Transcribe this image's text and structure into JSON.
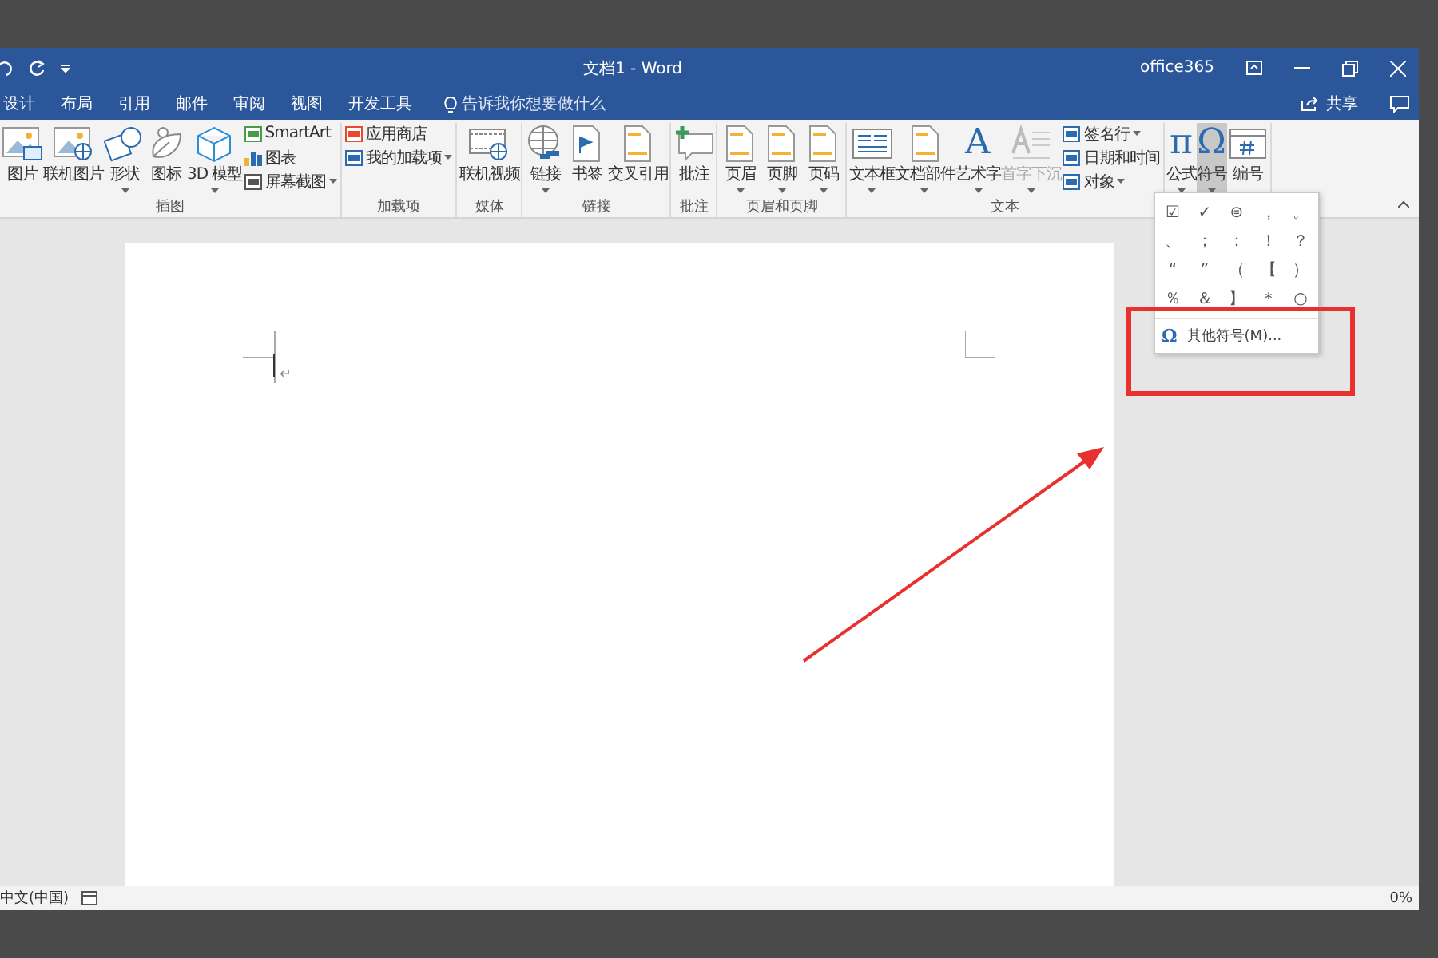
{
  "window": {
    "title": "文档1 - Word",
    "account": "office365"
  },
  "tabs": [
    {
      "label": "设计"
    },
    {
      "label": "布局"
    },
    {
      "label": "引用"
    },
    {
      "label": "邮件"
    },
    {
      "label": "审阅"
    },
    {
      "label": "视图"
    },
    {
      "label": "开发工具"
    }
  ],
  "tell_me": {
    "placeholder": "告诉我你想要做什么"
  },
  "share": {
    "label": "共享"
  },
  "ribbon": {
    "groups": [
      {
        "label": "插图",
        "buttons": [
          {
            "kind": "large",
            "label": "图片",
            "has_menu": false,
            "expanded": false,
            "disabled": false
          },
          {
            "kind": "large",
            "label": "联机图片",
            "has_menu": false,
            "expanded": false,
            "disabled": false
          },
          {
            "kind": "large",
            "label": "形状",
            "has_menu": true,
            "expanded": false,
            "disabled": false
          },
          {
            "kind": "large",
            "label": "图标",
            "has_menu": false,
            "expanded": false,
            "disabled": false
          },
          {
            "kind": "large",
            "label": "3D 模型",
            "has_menu": true,
            "expanded": false,
            "disabled": false
          },
          {
            "kind": "stack",
            "items": [
              {
                "label": "SmartArt",
                "has_menu": false
              },
              {
                "label": "图表",
                "has_menu": false
              },
              {
                "label": "屏幕截图",
                "has_menu": true
              }
            ]
          }
        ]
      },
      {
        "label": "加载项",
        "buttons": [
          {
            "kind": "stack",
            "items": [
              {
                "label": "应用商店",
                "has_menu": false
              },
              {
                "label": "我的加载项",
                "has_menu": true
              }
            ]
          }
        ]
      },
      {
        "label": "媒体",
        "buttons": [
          {
            "kind": "large",
            "label": "联机视频",
            "has_menu": false,
            "expanded": false,
            "disabled": false
          }
        ]
      },
      {
        "label": "链接",
        "buttons": [
          {
            "kind": "large",
            "label": "链接",
            "has_menu": true,
            "expanded": false,
            "disabled": false
          },
          {
            "kind": "large",
            "label": "书签",
            "has_menu": false,
            "expanded": false,
            "disabled": false
          },
          {
            "kind": "large",
            "label": "交叉引用",
            "has_menu": false,
            "expanded": false,
            "disabled": false
          }
        ]
      },
      {
        "label": "批注",
        "buttons": [
          {
            "kind": "large",
            "label": "批注",
            "has_menu": false,
            "expanded": false,
            "disabled": false
          }
        ]
      },
      {
        "label": "页眉和页脚",
        "buttons": [
          {
            "kind": "large",
            "label": "页眉",
            "has_menu": true,
            "expanded": false,
            "disabled": false
          },
          {
            "kind": "large",
            "label": "页脚",
            "has_menu": true,
            "expanded": false,
            "disabled": false
          },
          {
            "kind": "large",
            "label": "页码",
            "has_menu": true,
            "expanded": false,
            "disabled": false
          }
        ]
      },
      {
        "label": "文本",
        "buttons": [
          {
            "kind": "large",
            "label": "文本框",
            "has_menu": true,
            "expanded": false,
            "disabled": false
          },
          {
            "kind": "large",
            "label": "文档部件",
            "has_menu": true,
            "expanded": false,
            "disabled": false
          },
          {
            "kind": "large",
            "label": "艺术字",
            "glyph": "A",
            "has_menu": true,
            "expanded": false,
            "disabled": false
          },
          {
            "kind": "large",
            "label": "首字下沉",
            "has_menu": true,
            "expanded": false,
            "disabled": true
          },
          {
            "kind": "stack",
            "items": [
              {
                "label": "签名行",
                "has_menu": true
              },
              {
                "label": "日期和时间",
                "has_menu": false
              },
              {
                "label": "对象",
                "has_menu": true
              }
            ]
          }
        ]
      },
      {
        "buttons": [
          {
            "kind": "large",
            "label": "公式",
            "glyph": "π",
            "has_menu": true,
            "expanded": false,
            "disabled": false
          },
          {
            "kind": "large",
            "label": "符号",
            "glyph": "Ω",
            "has_menu": true,
            "expanded": true,
            "disabled": false
          },
          {
            "kind": "large",
            "label": "编号",
            "has_menu": false,
            "expanded": false,
            "disabled": false
          }
        ]
      }
    ]
  },
  "symbol_menu": {
    "symbols": [
      "☑",
      "✓",
      "⊜",
      "，",
      "。",
      "、",
      "；",
      "：",
      "！",
      "？",
      "“",
      "”",
      "（",
      "【",
      "）",
      "％",
      "＆",
      "】",
      "＊",
      "○"
    ],
    "more_item": {
      "glyph": "Ω",
      "label": "其他符号(M)..."
    }
  },
  "document": {
    "paragraph_mark": "↵"
  },
  "status_bar": {
    "language": "中文(中国)",
    "zoom": "0%"
  }
}
